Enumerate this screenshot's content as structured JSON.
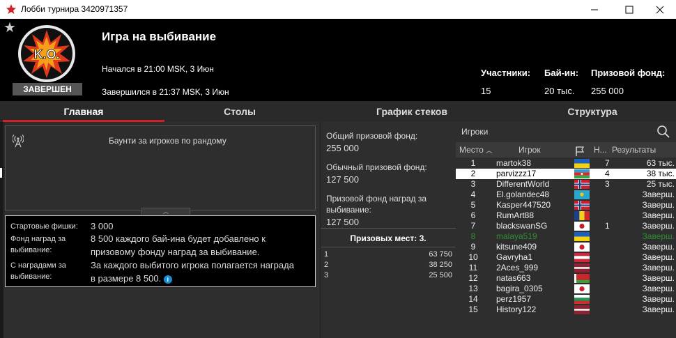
{
  "window": {
    "title": "Лобби турнира 3420971357",
    "minimize_icon": "minimize-icon",
    "maximize_icon": "maximize-icon",
    "close_icon": "close-icon"
  },
  "header": {
    "favorite_icon": "star-icon",
    "logo_text": "K.O.",
    "status_badge": "ЗАВЕРШЕН",
    "tournament_name": "Игра на выбивание",
    "started": "Начался в 21:00 MSK, 3 Июн",
    "finished": "Завершился в 21:37 MSK, 3 Июн",
    "participants_label": "Участники:",
    "participants_value": "15",
    "buyin_label": "Бай-ин:",
    "buyin_value": "20 тыс.",
    "prizepool_label": "Призовой фонд:",
    "prizepool_value": "255 000"
  },
  "tabs": [
    {
      "label": "Главная",
      "active": true
    },
    {
      "label": "Столы",
      "active": false
    },
    {
      "label": "График стеков",
      "active": false
    },
    {
      "label": "Структура",
      "active": false
    }
  ],
  "description": {
    "icon": "broadcast-antenna-icon",
    "text": "Баунти за игроков по рандому",
    "collapse_icon": "chevron-up-icon"
  },
  "info": {
    "rows": [
      {
        "label": "Стартовые фишки:",
        "value": "3 000"
      },
      {
        "label": "Фонд наград за выбивание:",
        "value": "8 500 каждого бай-ина будет добавлено к призовому фонду наград за выбивание."
      },
      {
        "label": "С наградами за выбивание:",
        "value": "За каждого выбитого игрока полагается награда в размере 8 500."
      }
    ],
    "info_icon": "info-icon"
  },
  "prize": {
    "total_label": "Общий призовой фонд:",
    "total_value": "255 000",
    "regular_label": "Обычный призовой фонд:",
    "regular_value": "127 500",
    "bounty_label": "Призовой фонд наград за выбивание:",
    "bounty_value": "127 500",
    "paid_places": "Призовых мест: 3.",
    "payouts": [
      {
        "place": "1",
        "amount": "63 750"
      },
      {
        "place": "2",
        "amount": "38 250"
      },
      {
        "place": "3",
        "amount": "25 500"
      }
    ]
  },
  "players": {
    "search_placeholder": "Игроки",
    "search_icon": "magnifier-icon",
    "columns": {
      "place": "Место",
      "sort_icon": "sort-ascending-icon",
      "name": "Игрок",
      "flag_icon": "flag-icon",
      "ko": "Н...",
      "results": "Результаты"
    },
    "rows": [
      {
        "place": "1",
        "name": "martok38",
        "flag": "Украина",
        "ko": "7",
        "result": "63 тыс.",
        "state": "normal"
      },
      {
        "place": "2",
        "name": "parvizzz17",
        "flag": "Азербайджан",
        "ko": "4",
        "result": "38 тыс.",
        "state": "selected"
      },
      {
        "place": "3",
        "name": "DifferentWorld",
        "flag": "Норвегия",
        "ko": "3",
        "result": "25 тыс.",
        "state": "normal"
      },
      {
        "place": "4",
        "name": "El.golandec48",
        "flag": "Казахстан",
        "ko": "",
        "result": "Заверш.",
        "state": "normal"
      },
      {
        "place": "5",
        "name": "Kasper447520",
        "flag": "Норвегия",
        "ko": "",
        "result": "Заверш.",
        "state": "normal"
      },
      {
        "place": "6",
        "name": "RumArt88",
        "flag": "Румыния",
        "ko": "",
        "result": "Заверш.",
        "state": "normal"
      },
      {
        "place": "7",
        "name": "blackswanSG",
        "flag": "Япония",
        "ko": "1",
        "result": "Заверш.",
        "state": "normal"
      },
      {
        "place": "8",
        "name": "malaya519",
        "flag": "Украина",
        "ko": "",
        "result": "Заверш.",
        "state": "eliminated"
      },
      {
        "place": "9",
        "name": "kitsune409",
        "flag": "Япония",
        "ko": "",
        "result": "Заверш.",
        "state": "normal"
      },
      {
        "place": "10",
        "name": "Gavryha1",
        "flag": "Австрия",
        "ko": "",
        "result": "Заверш.",
        "state": "normal"
      },
      {
        "place": "11",
        "name": "2Aces_999",
        "flag": "Латвия",
        "ko": "",
        "result": "Заверш.",
        "state": "normal"
      },
      {
        "place": "12",
        "name": "natas663",
        "flag": "Беларусь",
        "ko": "",
        "result": "Заверш.",
        "state": "normal"
      },
      {
        "place": "13",
        "name": "bagira_0305",
        "flag": "Япония",
        "ko": "",
        "result": "Заверш.",
        "state": "normal"
      },
      {
        "place": "14",
        "name": "perz1957",
        "flag": "Болгария",
        "ko": "",
        "result": "Заверш.",
        "state": "normal"
      },
      {
        "place": "15",
        "name": "History122",
        "flag": "Латвия",
        "ko": "",
        "result": "Заверш.",
        "state": "normal"
      }
    ]
  },
  "colors": {
    "accent": "#d21e25",
    "eliminated": "#2f8f2f",
    "info": "#1a8fd6"
  }
}
